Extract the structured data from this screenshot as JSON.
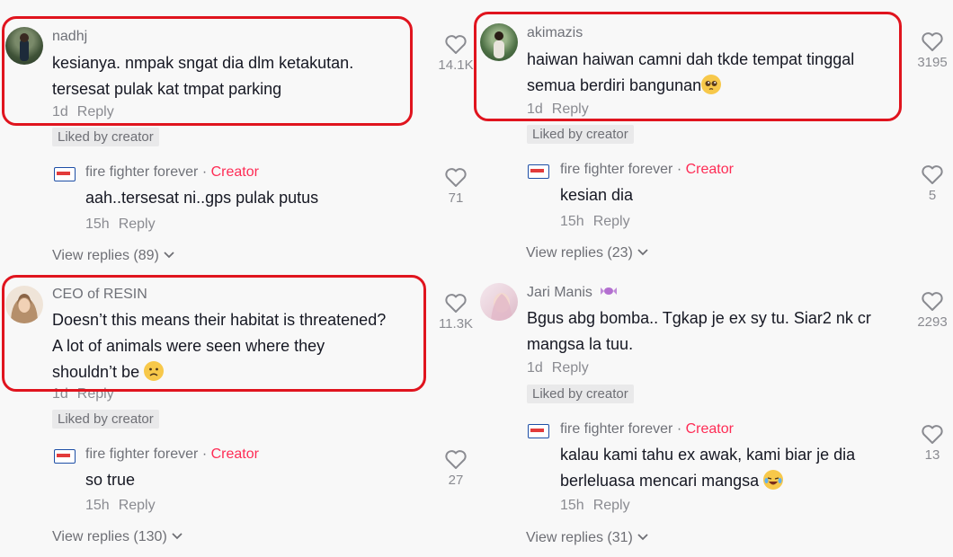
{
  "colors": {
    "creator": "#fe2c55",
    "highlight": "#e0141e",
    "text": "#161823",
    "muted": "#8a8b91"
  },
  "left": {
    "c1": {
      "username": "nadhj",
      "text_line1": "kesianya. nmpak sngat dia dlm ketakutan.",
      "text_line2": "tersesat pulak kat tmpat parking",
      "age": "1d",
      "reply": "Reply",
      "liked": "Liked by creator",
      "likes": "14.1K",
      "avatar_icon": "avatar-photo-icon"
    },
    "r1": {
      "username": "fire fighter forever",
      "sep": "·",
      "creator": "Creator",
      "text": "aah..tersesat ni..gps pulak putus",
      "age": "15h",
      "reply": "Reply",
      "likes": "71"
    },
    "vr1": "View replies (89)",
    "c2": {
      "username": "CEO of RESIN",
      "text_line1": "Doesn’t this means their habitat is threatened?",
      "text_line2": "A lot of animals were seen where they",
      "text_line3": "shouldn’t be",
      "age": "1d",
      "reply": "Reply",
      "liked": "Liked by creator",
      "likes": "11.3K",
      "emoji": "frowning-face-emoji"
    },
    "r2": {
      "username": "fire fighter forever",
      "sep": "·",
      "creator": "Creator",
      "text": "so true",
      "age": "15h",
      "reply": "Reply",
      "likes": "27"
    },
    "vr2": "View replies (130)"
  },
  "right": {
    "c1": {
      "username": "akimazis",
      "text_line1": "haiwan haiwan camni dah tkde tempat tinggal",
      "text_line2": "semua berdiri bangunan",
      "age": "1d",
      "reply": "Reply",
      "liked": "Liked by creator",
      "likes": "3195",
      "emoji": "pleading-face-emoji"
    },
    "r1": {
      "username": "fire fighter forever",
      "sep": "·",
      "creator": "Creator",
      "text": "kesian dia",
      "age": "15h",
      "reply": "Reply",
      "likes": "5"
    },
    "vr1": "View replies (23)",
    "c2": {
      "username": "Jari Manis",
      "text_line1": "Bgus abg bomba.. Tgkap je ex sy tu. Siar2 nk cr",
      "text_line2": "mangsa la tuu.",
      "age": "1d",
      "reply": "Reply",
      "liked": "Liked by creator",
      "likes": "2293",
      "name_emoji": "candy-emoji"
    },
    "r2": {
      "username": "fire fighter forever",
      "sep": "·",
      "creator": "Creator",
      "text_line1": "kalau kami tahu ex awak, kami biar je dia",
      "text_line2": "berleluasa mencari mangsa",
      "age": "15h",
      "reply": "Reply",
      "likes": "13",
      "emoji": "laughing-face-emoji"
    },
    "vr2": "View replies (31)"
  }
}
